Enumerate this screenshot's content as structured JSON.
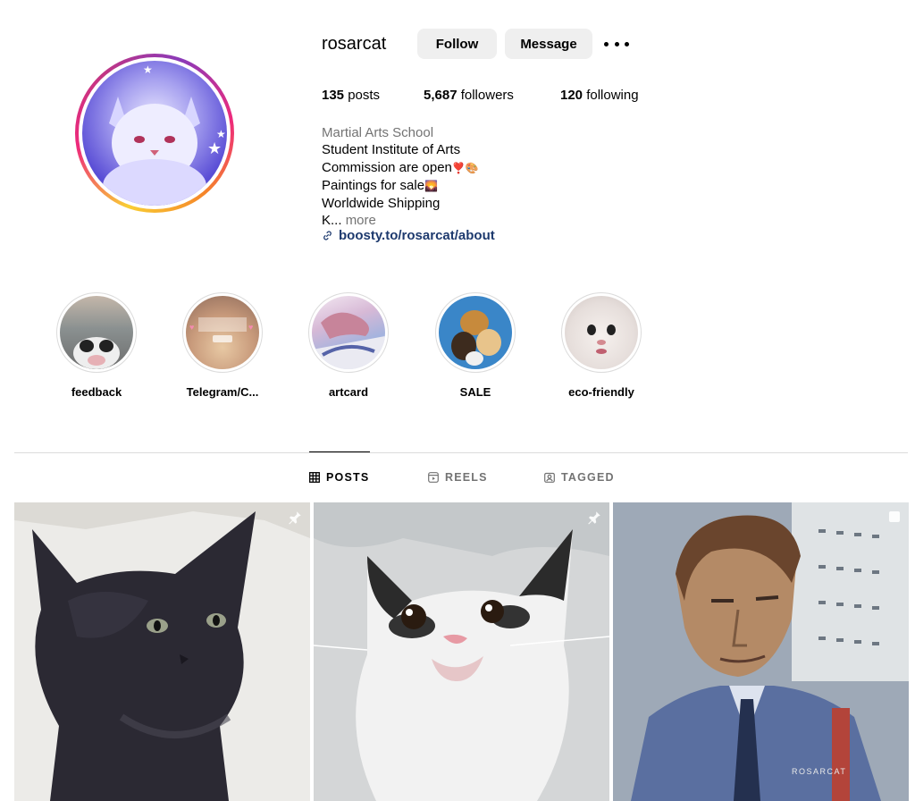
{
  "profile": {
    "username": "rosarcat",
    "follow_label": "Follow",
    "message_label": "Message",
    "posts_count": "135",
    "posts_label": "posts",
    "followers_count": "5,687",
    "followers_label": "followers",
    "following_count": "120",
    "following_label": "following"
  },
  "bio": {
    "category": "Martial Arts School",
    "line1": "Student Institute of Arts",
    "line2": "Commission are open",
    "line2_emoji": "❣️🎨",
    "line3": "Paintings for sale",
    "line3_emoji": "🌄",
    "line4": "Worldwide Shipping",
    "line5": "K...",
    "more_label": "more",
    "link": "boosty.to/rosarcat/about"
  },
  "highlights": [
    {
      "label": "feedback",
      "icon": "cat-photo"
    },
    {
      "label": "Telegram/C...",
      "icon": "telegram-promo"
    },
    {
      "label": "artcard",
      "icon": "artwork"
    },
    {
      "label": "SALE",
      "icon": "cats-pattern"
    },
    {
      "label": "eco-friendly",
      "icon": "kitten-photo"
    }
  ],
  "tabs": {
    "posts": "POSTS",
    "reels": "REELS",
    "tagged": "TAGGED"
  },
  "posts": [
    {
      "subject": "black-cat-painting",
      "pinned": true
    },
    {
      "subject": "white-cat-painting",
      "pinned": true
    },
    {
      "subject": "man-portrait-painting",
      "pinned": false,
      "signature": "ROSARCAT"
    }
  ],
  "colors": {
    "button_bg": "#efefef",
    "link": "#1e3a6e",
    "muted": "#737373",
    "divider": "#dbdbdb"
  }
}
